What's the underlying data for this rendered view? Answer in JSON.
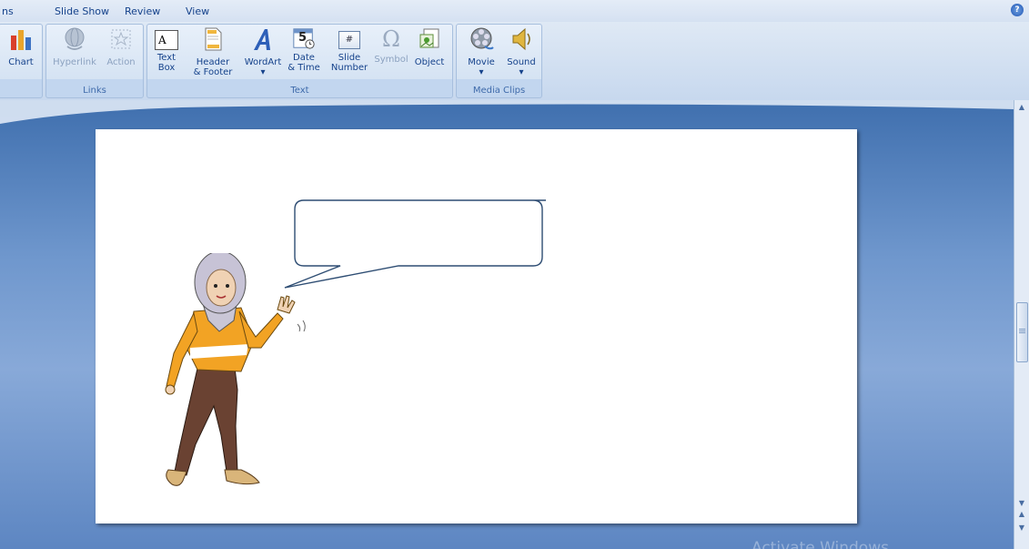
{
  "tabs": [
    {
      "label": "ns"
    },
    {
      "label": "Slide Show"
    },
    {
      "label": "Review"
    },
    {
      "label": "View"
    }
  ],
  "help_label": "?",
  "ribbon": {
    "groups": {
      "partial": {
        "label": ""
      },
      "links": {
        "label": "Links"
      },
      "text": {
        "label": "Text"
      },
      "media": {
        "label": "Media Clips"
      }
    },
    "buttons": {
      "chart": {
        "label": "Chart",
        "icon": "chart-icon"
      },
      "hyperlink": {
        "label": "Hyperlink",
        "icon": "hyperlink-globe-icon"
      },
      "action": {
        "label": "Action",
        "icon": "action-star-icon"
      },
      "textbox": {
        "line1": "Text",
        "line2": "Box",
        "icon": "textbox-icon"
      },
      "headerfooter": {
        "line1": "Header",
        "line2": "& Footer",
        "icon": "header-footer-icon"
      },
      "wordart": {
        "line1": "WordArt",
        "line2": "▾",
        "icon": "wordart-icon"
      },
      "datetime": {
        "line1": "Date",
        "line2": "& Time",
        "icon": "calendar-icon"
      },
      "slidenumber": {
        "line1": "Slide",
        "line2": "Number",
        "icon": "slide-number-icon"
      },
      "symbol": {
        "label": "Symbol",
        "icon": "omega-icon",
        "glyph": "Ω"
      },
      "object": {
        "label": "Object",
        "icon": "object-icon"
      },
      "movie": {
        "line1": "Movie",
        "line2": "▾",
        "icon": "film-reel-icon"
      },
      "sound": {
        "line1": "Sound",
        "line2": "▾",
        "icon": "speaker-icon"
      }
    },
    "calendar_digit": "5",
    "slide_number_glyph": "#",
    "textbox_glyph": "A"
  },
  "watermark": "Activate Windows",
  "colors": {
    "accent": "#15428b",
    "canvas": "#5d86c2",
    "slide": "#ffffff"
  }
}
